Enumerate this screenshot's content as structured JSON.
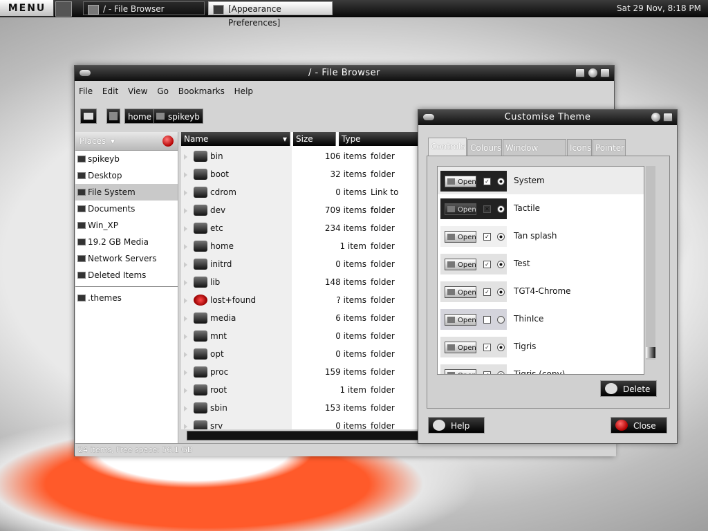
{
  "panel": {
    "menu_label": "MENU",
    "tasks": [
      {
        "label": "/ - File Browser"
      },
      {
        "label": "[Appearance Preferences]"
      }
    ],
    "clock": "Sat 29 Nov,  8:18 PM"
  },
  "file_browser": {
    "title": "/ - File Browser",
    "menu": [
      "File",
      "Edit",
      "View",
      "Go",
      "Bookmarks",
      "Help"
    ],
    "path": [
      "home",
      "spikeyb"
    ],
    "places_label": "Places",
    "places": [
      {
        "label": "spikeyb"
      },
      {
        "label": "Desktop"
      },
      {
        "label": "File System",
        "selected": true
      },
      {
        "label": "Documents"
      },
      {
        "label": "Win_XP"
      },
      {
        "label": "19.2 GB Media"
      },
      {
        "label": "Network Servers"
      },
      {
        "label": "Deleted Items"
      },
      {
        "label": ".themes"
      }
    ],
    "columns": {
      "name": "Name",
      "size": "Size",
      "type": "Type"
    },
    "rows": [
      {
        "name": "bin",
        "size": "106 items",
        "type": "folder"
      },
      {
        "name": "boot",
        "size": "32 items",
        "type": "folder"
      },
      {
        "name": "cdrom",
        "size": "0 items",
        "type": "Link to folder"
      },
      {
        "name": "dev",
        "size": "709 items",
        "type": "folder"
      },
      {
        "name": "etc",
        "size": "234 items",
        "type": "folder"
      },
      {
        "name": "home",
        "size": "1 item",
        "type": "folder"
      },
      {
        "name": "initrd",
        "size": "0 items",
        "type": "folder"
      },
      {
        "name": "lib",
        "size": "148 items",
        "type": "folder"
      },
      {
        "name": "lost+found",
        "size": "? items",
        "type": "folder"
      },
      {
        "name": "media",
        "size": "6 items",
        "type": "folder"
      },
      {
        "name": "mnt",
        "size": "0 items",
        "type": "folder"
      },
      {
        "name": "opt",
        "size": "0 items",
        "type": "folder"
      },
      {
        "name": "proc",
        "size": "159 items",
        "type": "folder"
      },
      {
        "name": "root",
        "size": "1 item",
        "type": "folder"
      },
      {
        "name": "sbin",
        "size": "153 items",
        "type": "folder"
      },
      {
        "name": "srv",
        "size": "0 items",
        "type": "folder"
      }
    ],
    "status": "24 items, Free space: 56.1 GB"
  },
  "theme_dialog": {
    "title": "Customise Theme",
    "tabs": [
      "Controls",
      "Colours",
      "Window Border",
      "Icons",
      "Pointer"
    ],
    "preview_button": "Open",
    "themes": [
      {
        "name": "System"
      },
      {
        "name": "Tactile"
      },
      {
        "name": "Tan splash"
      },
      {
        "name": "Test"
      },
      {
        "name": "TGT4-Chrome"
      },
      {
        "name": "ThinIce"
      },
      {
        "name": "Tigris"
      },
      {
        "name": "Tigris (copy)"
      }
    ],
    "delete_label": "Delete",
    "help_label": "Help",
    "close_label": "Close"
  }
}
